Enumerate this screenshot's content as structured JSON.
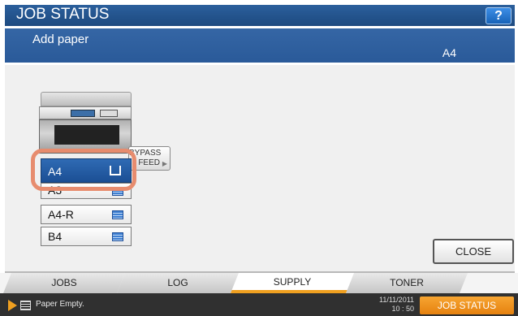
{
  "header": {
    "title": "JOB STATUS",
    "help_label": "?",
    "message": "Add paper",
    "paper_size": "A4"
  },
  "supply": {
    "bypass_label_line1": "BYPASS",
    "bypass_label_line2": "FEED",
    "trays": [
      {
        "label": "A4",
        "selected": true
      },
      {
        "label": "A3",
        "selected": false
      },
      {
        "label": "A4-R",
        "selected": false
      },
      {
        "label": "B4",
        "selected": false
      }
    ],
    "close_label": "CLOSE"
  },
  "tabs": [
    {
      "label": "JOBS",
      "active": false
    },
    {
      "label": "LOG",
      "active": false
    },
    {
      "label": "SUPPLY",
      "active": true
    },
    {
      "label": "TONER",
      "active": false
    }
  ],
  "status_bar": {
    "message": "Paper Empty.",
    "date": "11/11/2011",
    "time": "10 : 50",
    "job_status_label": "JOB STATUS"
  },
  "colors": {
    "header_blue": "#2b5f9c",
    "selected_tray": "#1b4f94",
    "highlight_ring": "#e78c6e",
    "accent_orange": "#f0a020"
  }
}
